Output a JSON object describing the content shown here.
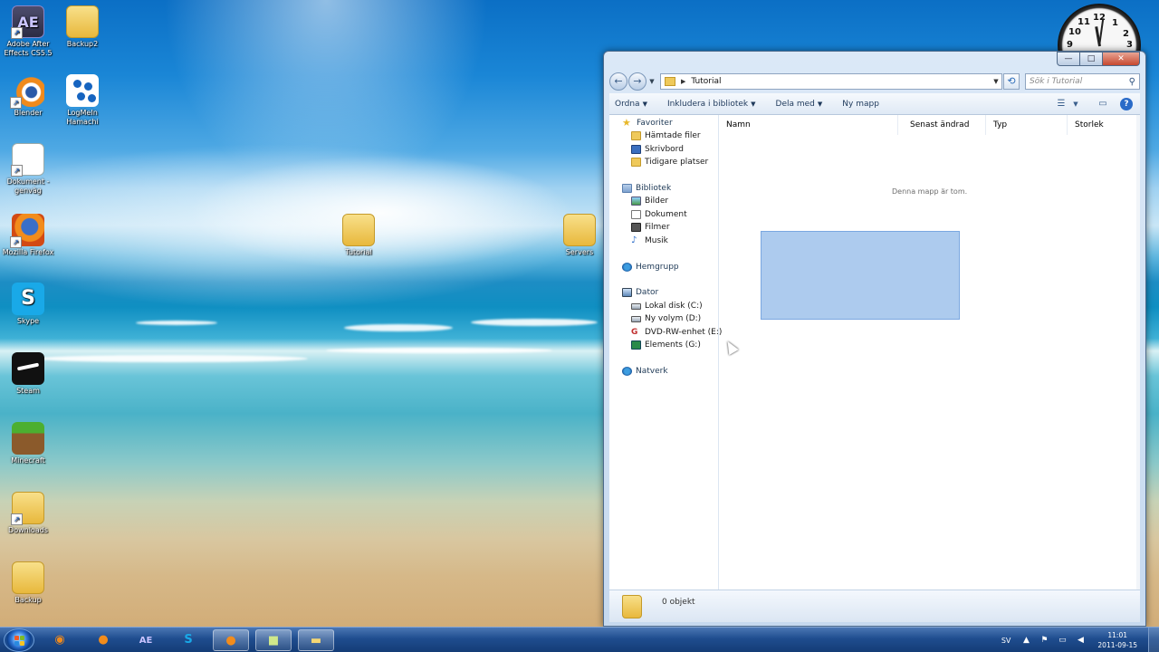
{
  "desktop": {
    "icons": [
      {
        "label": "Adobe After Effects CS5.5",
        "icon": "after-effects-icon"
      },
      {
        "label": "Backup2",
        "icon": "folder-icon"
      },
      {
        "label": "Blender",
        "icon": "blender-icon"
      },
      {
        "label": "LogMeIn Hamachi",
        "icon": "hamachi-icon"
      },
      {
        "label": "Dokument - genväg",
        "icon": "document-icon"
      },
      {
        "label": "Mozilla Firefox",
        "icon": "firefox-icon"
      },
      {
        "label": "Skype",
        "icon": "skype-icon"
      },
      {
        "label": "Steam",
        "icon": "steam-icon"
      },
      {
        "label": "Minecraft",
        "icon": "minecraft-icon"
      },
      {
        "label": "Downloads",
        "icon": "folder-icon"
      },
      {
        "label": "Backup",
        "icon": "folder-icon"
      },
      {
        "label": "Tutorial",
        "icon": "folder-icon"
      },
      {
        "label": "Servers",
        "icon": "folder-icon"
      }
    ],
    "clock_gadget": {
      "numerals": [
        "12",
        "1",
        "2",
        "3",
        "9",
        "10",
        "11"
      ]
    }
  },
  "window": {
    "controls": {
      "minimize": "—",
      "maximize": "□",
      "close": "✕"
    },
    "address": {
      "path": "Tutorial"
    },
    "search": {
      "placeholder": "Sök i Tutorial"
    },
    "toolbar": {
      "organize": "Ordna",
      "include_library": "Inkludera i bibliotek",
      "share_with": "Dela med",
      "new_folder": "Ny mapp"
    },
    "nav": {
      "favorites": {
        "label": "Favoriter",
        "items": [
          "Hämtade filer",
          "Skrivbord",
          "Tidigare platser"
        ]
      },
      "libraries": {
        "label": "Bibliotek",
        "items": [
          "Bilder",
          "Dokument",
          "Filmer",
          "Musik"
        ]
      },
      "homegroup": {
        "label": "Hemgrupp"
      },
      "computer": {
        "label": "Dator",
        "items": [
          "Lokal disk (C:)",
          "Ny volym (D:)",
          "DVD-RW-enhet (E:)",
          "Elements (G:)"
        ]
      },
      "network": {
        "label": "Natverk"
      }
    },
    "columns": [
      "Namn",
      "Senast ändrad",
      "Typ",
      "Storlek"
    ],
    "empty_message": "Denna mapp är tom.",
    "status": {
      "count": "0 objekt"
    }
  },
  "taskbar": {
    "language": "SV",
    "time": "11:01",
    "date": "2011-09-15",
    "apps": [
      {
        "name": "blender",
        "active": false
      },
      {
        "name": "firefox",
        "active": false
      },
      {
        "name": "after-effects",
        "active": false
      },
      {
        "name": "skype",
        "active": false
      },
      {
        "name": "firefox",
        "active": true
      },
      {
        "name": "camtasia",
        "active": true
      },
      {
        "name": "explorer",
        "active": true
      }
    ]
  }
}
